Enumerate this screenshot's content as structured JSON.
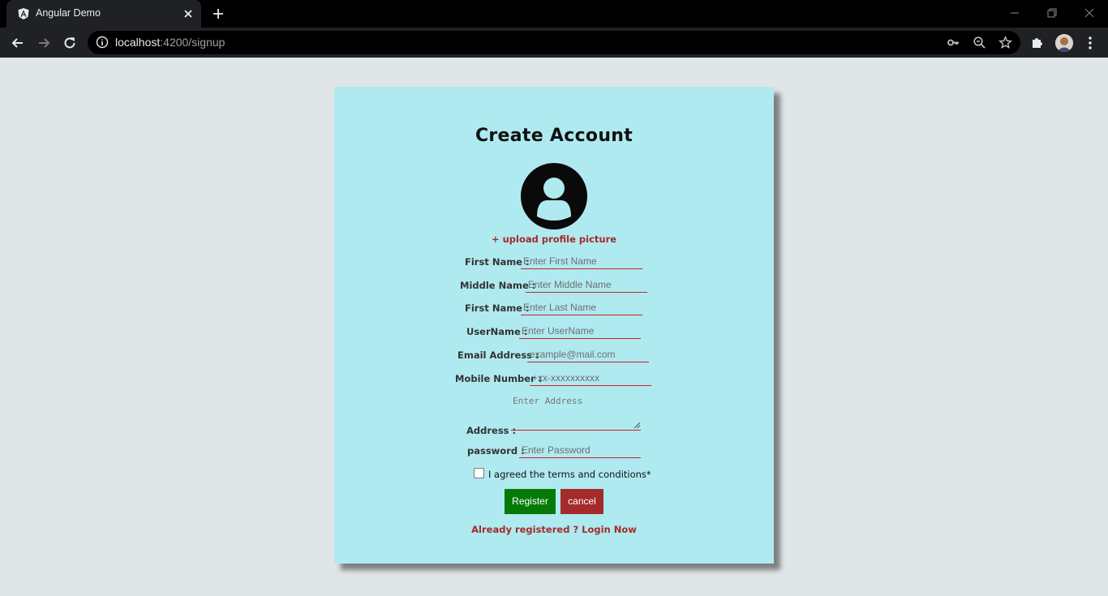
{
  "browser": {
    "tab_title": "Angular Demo",
    "url_host": "localhost",
    "url_rest": ":4200/signup",
    "icons": [
      "angular-favicon",
      "close-icon",
      "plus-icon",
      "back-arrow-icon",
      "forward-arrow-icon",
      "reload-icon",
      "info-icon",
      "key-icon",
      "zoom-icon",
      "star-icon",
      "puzzle-icon",
      "kebab-menu-icon",
      "minimize-icon",
      "restore-icon",
      "window-close-icon"
    ]
  },
  "form": {
    "title": "Create Account",
    "upload_label": "+ upload profile picture",
    "fields": {
      "first_name": {
        "label": "First Name :",
        "placeholder": "Enter First Name"
      },
      "middle_name": {
        "label": "Middle Name :",
        "placeholder": "Enter Middle Name"
      },
      "last_name": {
        "label": "First Name :",
        "placeholder": "Enter Last Name"
      },
      "username": {
        "label": "UserName :",
        "placeholder": "Enter UserName"
      },
      "email": {
        "label": "Email Address :",
        "placeholder": "example@mail.com"
      },
      "mobile": {
        "label": "Mobile Number :",
        "placeholder": "+xx-xxxxxxxxxx"
      },
      "address": {
        "label": "Address :",
        "placeholder": "Enter Address"
      },
      "password": {
        "label": "password :",
        "placeholder": "Enter Password"
      }
    },
    "terms_label": "I agreed the terms and conditions*",
    "register_label": "Register",
    "cancel_label": "cancel",
    "login_link": "Already registered ? Login Now"
  },
  "colors": {
    "card_bg": "#afeaf0",
    "page_bg": "#e0e6e7",
    "register": "#067a06",
    "cancel": "#a52a2a",
    "accent_link": "#a52a2a",
    "underline": "#cc2222"
  }
}
